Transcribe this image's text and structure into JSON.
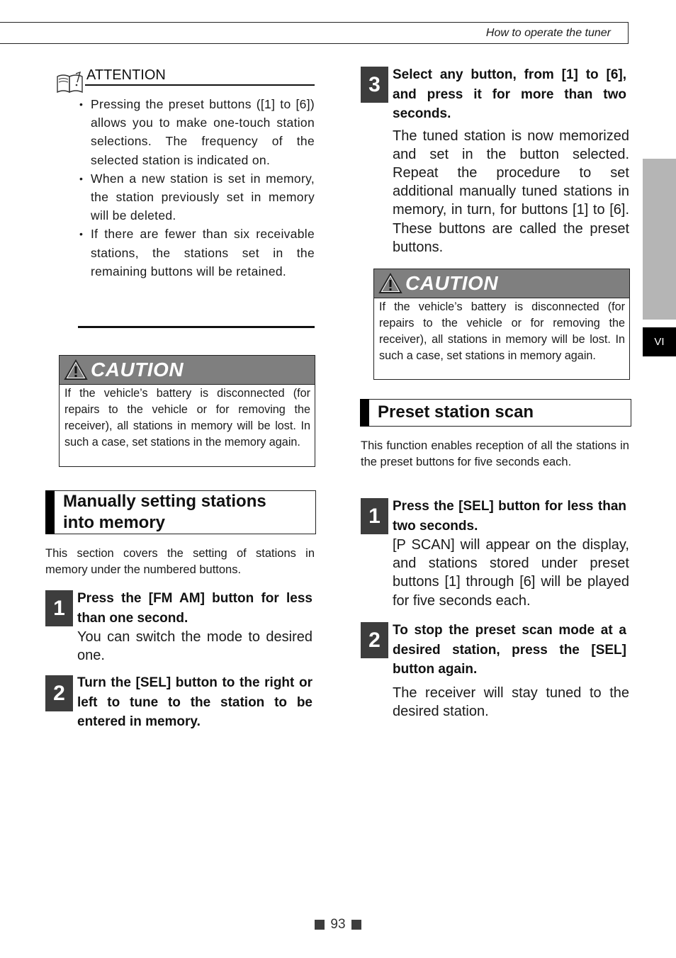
{
  "header": {
    "title": "How to operate the tuner"
  },
  "side_tab": {
    "label": "VI"
  },
  "attention": {
    "title": "ATTENTION",
    "icon": "book-attention-icon",
    "items": [
      "Pressing the preset buttons ([1] to [6]) allows you to make one-touch station selections. The frequency of the selected station is indicated on.",
      "When a new station is set in memory, the station previously set in memory will be deleted.",
      "If there are fewer than six receivable stations, the stations set in the remaining buttons will be retained."
    ]
  },
  "caution_left": {
    "label": "CAUTION",
    "icon": "warning-triangle-icon",
    "text": "If the vehicle’s battery is disconnected (for repairs to the vehicle or for removing the receiver), all stations in memory will be lost. In such a case, set stations in the memory again."
  },
  "manual_section": {
    "title_line1": "Manually setting stations",
    "title_line2": "into memory",
    "intro": "This section covers the setting of stations in memory under the numbered buttons.",
    "steps": [
      {
        "num": "1",
        "head": "Press the [FM AM] button for less than one second.",
        "body": "You can switch the mode to desired one."
      },
      {
        "num": "2",
        "head": "Turn the [SEL] button to the right or left to tune to the station to be entered in memory.",
        "body": ""
      },
      {
        "num": "3",
        "head": "Select any button, from [1] to [6], and press it for more than two seconds.",
        "body": "The tuned station is now memorized and set in the button selected. Repeat the procedure to set additional manually tuned stations in memory, in turn, for buttons [1] to [6]. These buttons are called the preset buttons."
      }
    ]
  },
  "caution_right": {
    "label": "CAUTION",
    "icon": "warning-triangle-icon",
    "text": "If the vehicle’s battery is disconnected (for repairs to the vehicle or for removing the receiver), all stations in memory will be lost. In such a case, set stations in memory again."
  },
  "scan_section": {
    "title": "Preset station scan",
    "intro": "This function enables reception of all the stations in the preset buttons for five seconds each.",
    "steps": [
      {
        "num": "1",
        "head": "Press the [SEL] button for less than two seconds.",
        "body": "[P SCAN] will appear on the display, and stations stored under preset buttons [1] through [6] will be played for five seconds each."
      },
      {
        "num": "2",
        "head": "To stop the preset scan mode at a desired station, press the [SEL] button again.",
        "body": "The receiver will stay tuned to the desired station."
      }
    ]
  },
  "footer": {
    "page_number": "93"
  }
}
